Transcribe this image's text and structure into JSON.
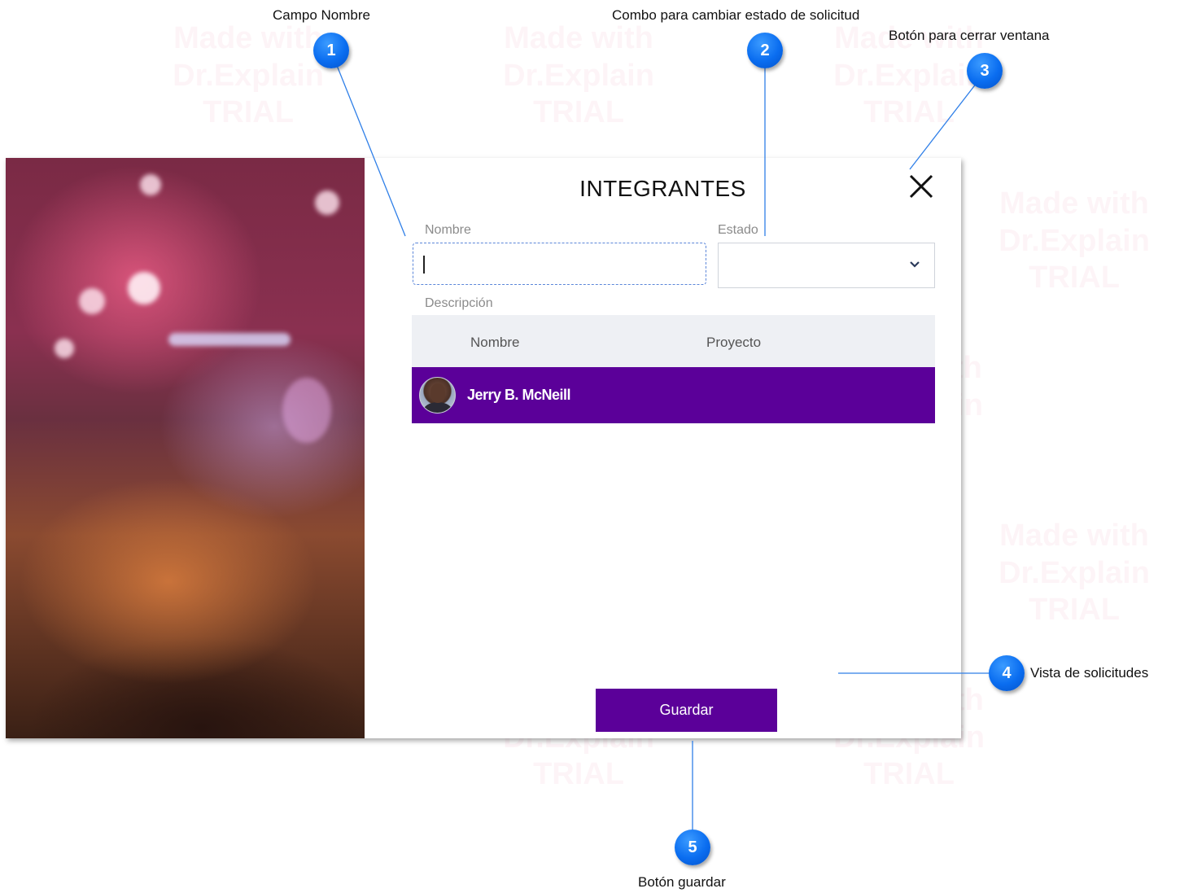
{
  "window": {
    "title": "INTEGRANTES",
    "close_icon": "close-icon",
    "nombre_label": "Nombre",
    "nombre_value": "",
    "estado_label": "Estado",
    "estado_value": "",
    "descripcion_label": "Descripción",
    "table": {
      "columns": [
        "Nombre",
        "Proyecto"
      ],
      "rows": [
        {
          "nombre": "Jerry B. McNeill",
          "proyecto": ""
        }
      ]
    },
    "save_label": "Guardar",
    "accent_color": "#5b0099"
  },
  "callouts": [
    {
      "number": "1",
      "text": "Campo Nombre"
    },
    {
      "number": "2",
      "text": "Combo para cambiar estado de solicitud"
    },
    {
      "number": "3",
      "text": "Botón para cerrar ventana"
    },
    {
      "number": "4",
      "text": "Vista de solicitudes"
    },
    {
      "number": "5",
      "text": "Botón guardar"
    }
  ],
  "watermark": {
    "line1": "Made with",
    "line2": "Dr.Explain",
    "line3": "TRIAL"
  }
}
